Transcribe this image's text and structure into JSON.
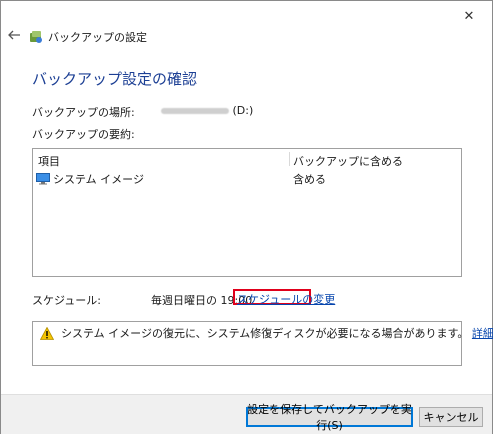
{
  "window": {
    "close_glyph": "✕",
    "app_title": "バックアップの設定"
  },
  "heading": "バックアップ設定の確認",
  "location": {
    "label": "バックアップの場所:",
    "value_suffix": "(D:)"
  },
  "summary": {
    "label": "バックアップの要約:",
    "columns": [
      "項目",
      "バックアップに含める"
    ],
    "rows": [
      {
        "item": "システム イメージ",
        "included": "含める"
      }
    ]
  },
  "schedule": {
    "label": "スケジュール:",
    "value": "毎週日曜日の 19:00",
    "change_link": "スケジュールの変更"
  },
  "warning": {
    "text": "システム イメージの復元に、システム修復ディスクが必要になる場合があります。",
    "link": "詳細情報"
  },
  "buttons": {
    "save_run": "設定を保存してバックアップを実行(S)",
    "cancel": "キャンセル"
  },
  "colors": {
    "heading": "#1c3f94",
    "link": "#0645ad",
    "highlight": "#e0001b"
  }
}
